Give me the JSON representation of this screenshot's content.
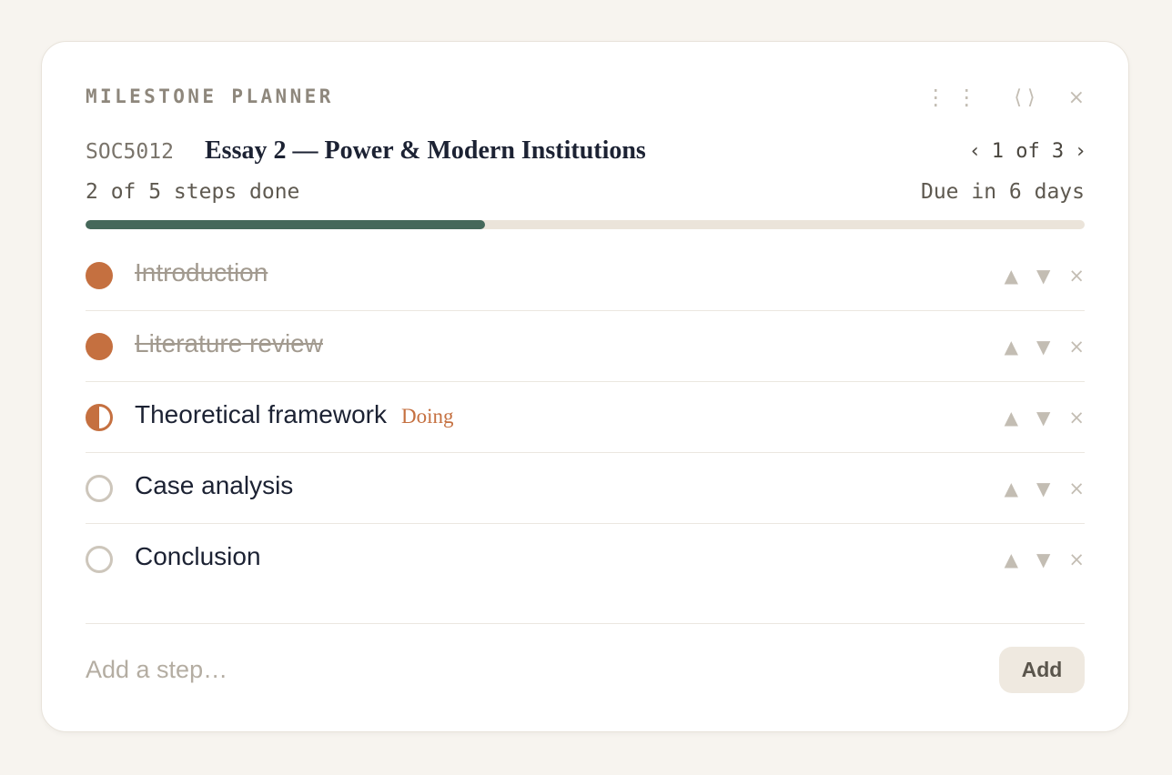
{
  "header": {
    "label": "MILESTONE PLANNER",
    "drag_icon": "⋮⋮",
    "expand_icon": "⟨⟩",
    "close_icon": "×"
  },
  "assignment": {
    "course_code": "SOC5012",
    "title": "Essay 2 — Power & Modern Institutions",
    "pager": {
      "prev_icon": "‹",
      "text": "1 of 3",
      "next_icon": "›"
    }
  },
  "progress": {
    "summary": "2 of 5 steps done",
    "due": "Due in 6 days",
    "fraction": 0.4
  },
  "step_actions": {
    "up_icon": "▲",
    "down_icon": "▼",
    "delete_icon": "×"
  },
  "steps": [
    {
      "label": "Introduction",
      "status": "done",
      "badge": ""
    },
    {
      "label": "Literature review",
      "status": "done",
      "badge": ""
    },
    {
      "label": "Theoretical framework",
      "status": "doing",
      "badge": "Doing"
    },
    {
      "label": "Case analysis",
      "status": "todo",
      "badge": ""
    },
    {
      "label": "Conclusion",
      "status": "todo",
      "badge": ""
    }
  ],
  "add": {
    "placeholder": "Add a step…",
    "value": "",
    "button_label": "Add"
  },
  "colors": {
    "accent": "#c57040",
    "progress_fill": "#45685a",
    "progress_track": "#ebe4da",
    "title_text": "#1c2233",
    "muted": "#c3bdb3"
  }
}
